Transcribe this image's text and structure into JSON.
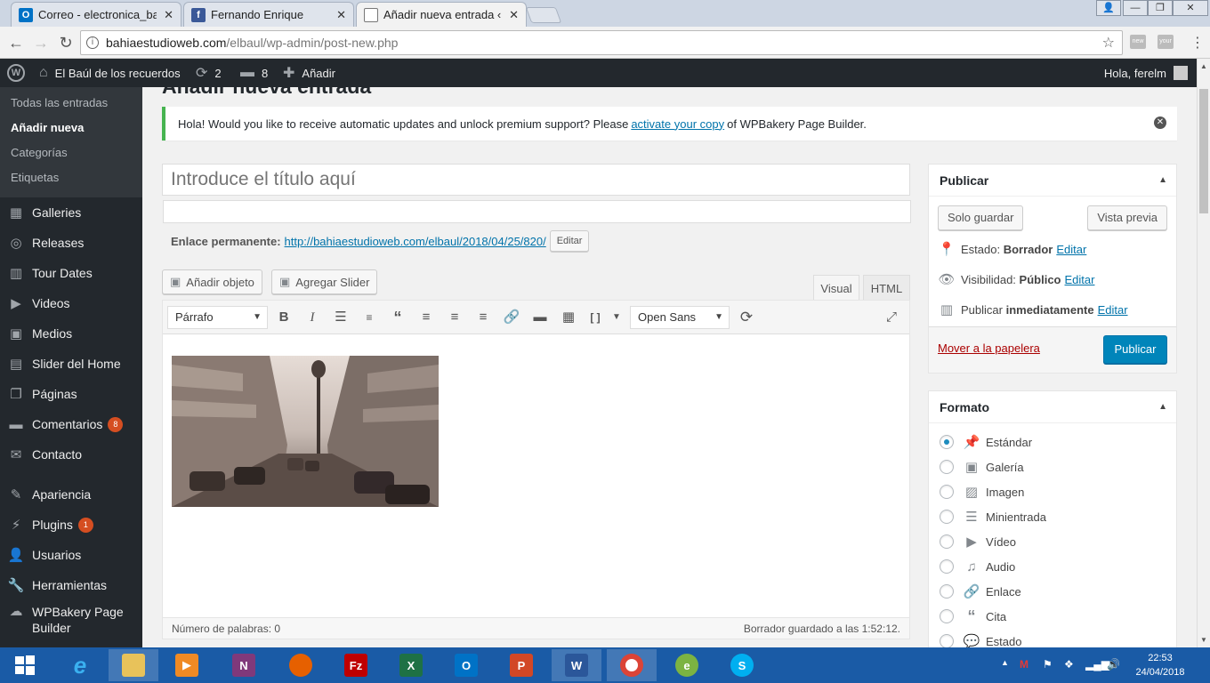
{
  "browser": {
    "tabs": [
      {
        "title": "Correo - electronica_bah",
        "icon": "outlook-icon",
        "color": "#0072c6"
      },
      {
        "title": "Fernando Enrique",
        "icon": "facebook-icon",
        "color": "#3b5998"
      },
      {
        "title": "Añadir nueva entrada ‹ E",
        "icon": "page-icon",
        "color": "#ffffff"
      }
    ],
    "url_domain": "bahiaestudioweb.com",
    "url_path": "/elbaul/wp-admin/post-new.php"
  },
  "adminbar": {
    "site_name": "El Baúl de los recuerdos",
    "updates": "2",
    "comments": "8",
    "add_new": "Añadir",
    "greeting": "Hola, ferelm"
  },
  "sidebar": {
    "submenu": [
      "Todas las entradas",
      "Añadir nueva",
      "Categorías",
      "Etiquetas"
    ],
    "items": [
      {
        "label": "Galleries"
      },
      {
        "label": "Releases"
      },
      {
        "label": "Tour Dates"
      },
      {
        "label": "Videos"
      },
      {
        "label": "Medios"
      },
      {
        "label": "Slider del Home"
      },
      {
        "label": "Páginas"
      },
      {
        "label": "Comentarios",
        "count": "8"
      },
      {
        "label": "Contacto"
      },
      {
        "label": "Apariencia"
      },
      {
        "label": "Plugins",
        "count": "1"
      },
      {
        "label": "Usuarios"
      },
      {
        "label": "Herramientas"
      },
      {
        "label": "WPBakery Page Builder"
      }
    ]
  },
  "page": {
    "title": "Añadir nueva entrada",
    "notice_before": "Hola! Would you like to receive automatic updates and unlock premium support? Please",
    "notice_link": "activate your copy",
    "notice_after": "of WPBakery Page Builder.",
    "title_placeholder": "Introduce el título aquí",
    "permalink_label": "Enlace permanente:",
    "permalink_url": "http://bahiaestudioweb.com/elbaul/2018/04/25/820/",
    "permalink_edit": "Editar",
    "add_media": "Añadir objeto",
    "add_slider": "Agregar Slider",
    "tab_visual": "Visual",
    "tab_html": "HTML",
    "format_select": "Párrafo",
    "font_select": "Open Sans",
    "word_count": "Número de palabras: 0",
    "draft_saved": "Borrador guardado a las 1:52:12."
  },
  "publish": {
    "title": "Publicar",
    "save_draft": "Solo guardar",
    "preview": "Vista previa",
    "status_label": "Estado:",
    "status_value": "Borrador",
    "visibility_label": "Visibilidad:",
    "visibility_value": "Público",
    "schedule_label": "Publicar",
    "schedule_value": "inmediatamente",
    "edit": "Editar",
    "trash": "Mover a la papelera",
    "publish": "Publicar"
  },
  "format": {
    "title": "Formato",
    "options": [
      "Estándar",
      "Galería",
      "Imagen",
      "Minientrada",
      "Vídeo",
      "Audio",
      "Enlace",
      "Cita",
      "Estado"
    ],
    "selected": "Estándar"
  },
  "taskbar": {
    "time": "22:53",
    "date": "24/04/2018"
  }
}
